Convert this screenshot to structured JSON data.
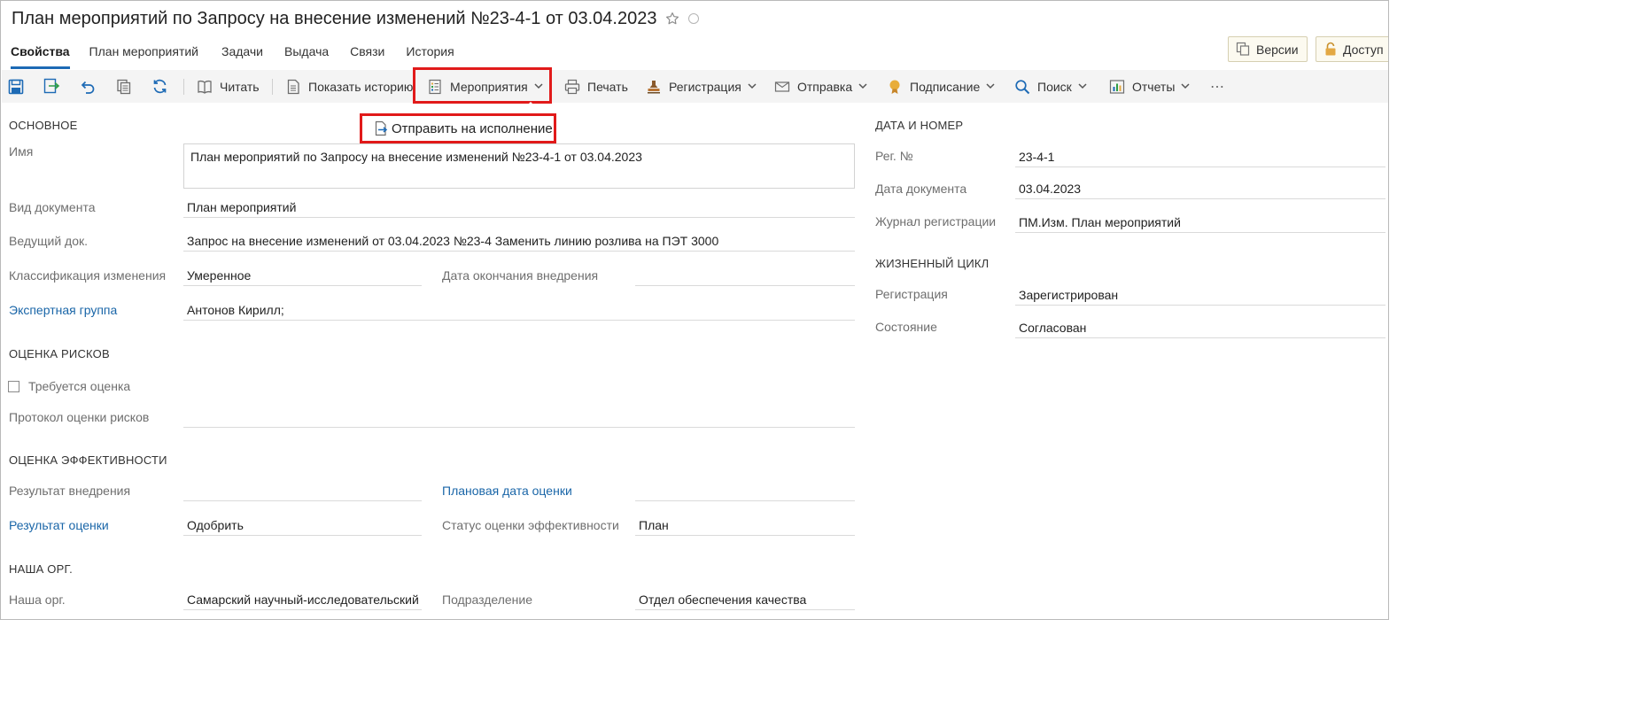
{
  "header": {
    "title": "План мероприятий по Запросу на внесение изменений №23-4-1 от 03.04.2023"
  },
  "tabs": [
    "Свойства",
    "План мероприятий",
    "Задачи",
    "Выдача",
    "Связи",
    "История"
  ],
  "top_buttons": {
    "versions": "Версии",
    "access": "Доступ"
  },
  "toolbar": {
    "read": "Читать",
    "show_history": "Показать историю",
    "events": "Мероприятия",
    "print": "Печать",
    "registration": "Регистрация",
    "sending": "Отправка",
    "signing": "Подписание",
    "search": "Поиск",
    "reports": "Отчеты",
    "more": "⋯"
  },
  "dropdown": {
    "send_to_execution": "Отправить на исполнение"
  },
  "main": {
    "section_main": "ОСНОВНОЕ",
    "name_label": "Имя",
    "name_value": "План мероприятий по Запросу на внесение изменений №23-4-1 от 03.04.2023",
    "doc_kind_label": "Вид документа",
    "doc_kind_value": "План мероприятий",
    "leading_doc_label": "Ведущий док.",
    "leading_doc_value": "Запрос на внесение изменений от 03.04.2023 №23-4 Заменить линию розлива на ПЭТ 3000",
    "change_class_label": "Классификация изменения",
    "change_class_value": "Умеренное",
    "impl_end_date_label": "Дата окончания внедрения",
    "impl_end_date_value": "",
    "expert_group_label": "Экспертная группа",
    "expert_group_value": "Антонов Кирилл;",
    "section_risk": "ОЦЕНКА РИСКОВ",
    "requires_assessment_label": "Требуется оценка",
    "requires_assessment_checked": false,
    "risk_protocol_label": "Протокол оценки рисков",
    "risk_protocol_value": "",
    "section_efficiency": "ОЦЕНКА ЭФФЕКТИВНОСТИ",
    "impl_result_label": "Результат внедрения",
    "impl_result_value": "",
    "planned_eval_date_label": "Плановая дата оценки",
    "planned_eval_date_value": "",
    "eval_result_label": "Результат оценки",
    "eval_result_value": "Одобрить",
    "eval_status_label": "Статус оценки эффективности",
    "eval_status_value": "План",
    "section_our_org": "НАША ОРГ.",
    "our_org_label": "Наша орг.",
    "our_org_value": "Самарский научный-исследовательский",
    "department_label": "Подразделение",
    "department_value": "Отдел обеспечения качества"
  },
  "right": {
    "section_date_number": "ДАТА И НОМЕР",
    "reg_no_label": "Рег. №",
    "reg_no_value": "23-4-1",
    "doc_date_label": "Дата документа",
    "doc_date_value": "03.04.2023",
    "reg_journal_label": "Журнал регистрации",
    "reg_journal_value": "ПМ.Изм. План мероприятий",
    "section_lifecycle": "ЖИЗНЕННЫЙ ЦИКЛ",
    "registration_label": "Регистрация",
    "registration_value": "Зарегистрирован",
    "state_label": "Состояние",
    "state_value": "Согласован"
  },
  "colors": {
    "accent": "#1d6ab5",
    "link": "#1a66a8",
    "highlight": "#e11a1a",
    "toolbar_bg": "#f4f4f4"
  }
}
